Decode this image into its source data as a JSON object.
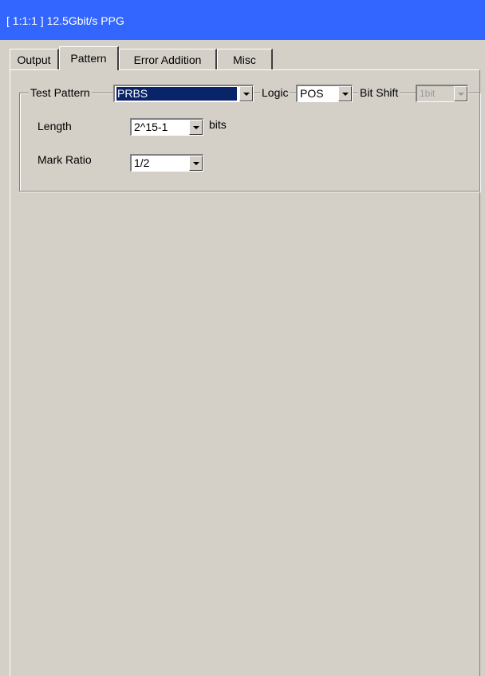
{
  "window": {
    "title": "[ 1:1:1 ] 12.5Gbit/s PPG",
    "title_bar_color": "#3366ff"
  },
  "tabs": [
    {
      "label": "Output",
      "active": false
    },
    {
      "label": "Pattern",
      "active": true
    },
    {
      "label": "Error Addition",
      "active": false
    },
    {
      "label": "Misc",
      "active": false
    }
  ],
  "pattern_panel": {
    "test_pattern": {
      "label": "Test Pattern",
      "value": "PRBS"
    },
    "logic": {
      "label": "Logic",
      "value": "POS"
    },
    "bit_shift": {
      "label": "Bit Shift",
      "value": "1bit",
      "enabled": false
    },
    "length": {
      "label": "Length",
      "value": "2^15-1",
      "unit": "bits"
    },
    "mark_ratio": {
      "label": "Mark Ratio",
      "value": "1/2"
    }
  },
  "colors": {
    "panel_background": "#d4d0c8",
    "selection_background": "#0a246a"
  }
}
